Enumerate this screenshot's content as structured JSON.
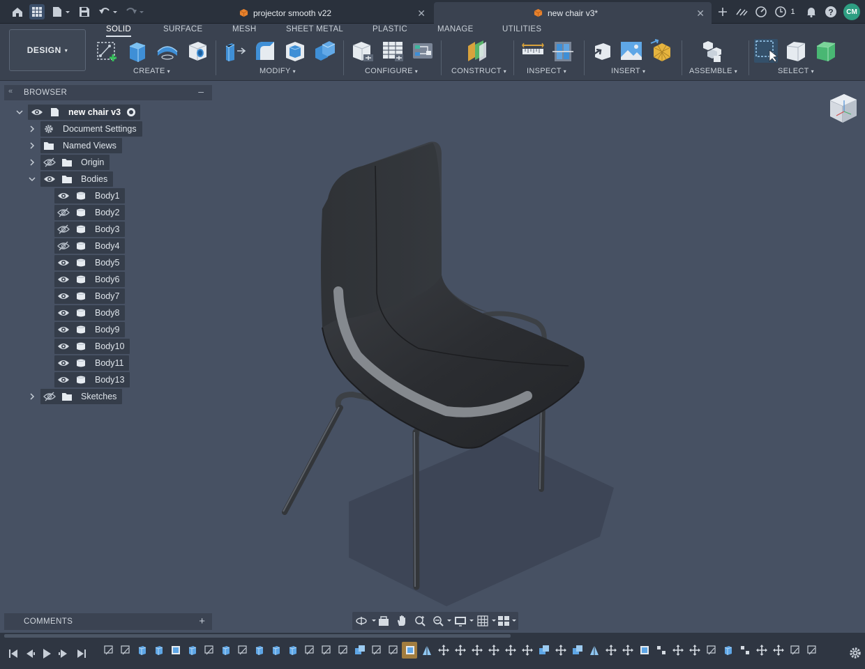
{
  "tabs": [
    {
      "title": "projector smooth v22",
      "active": false
    },
    {
      "title": "new chair v3*",
      "active": true
    }
  ],
  "titlebar": {
    "job_count": "1",
    "user_initials": "CM"
  },
  "workspace": {
    "label": "DESIGN",
    "caret": "▾"
  },
  "toolbar": {
    "tabs": [
      "SOLID",
      "SURFACE",
      "MESH",
      "SHEET METAL",
      "PLASTIC",
      "MANAGE",
      "UTILITIES"
    ],
    "groups": [
      "CREATE",
      "MODIFY",
      "CONFIGURE",
      "CONSTRUCT",
      "INSPECT",
      "INSERT",
      "ASSEMBLE",
      "SELECT"
    ],
    "caret": "▾"
  },
  "browser": {
    "title": "BROWSER",
    "root": "new chair v3",
    "folders": [
      "Document Settings",
      "Named Views",
      "Origin",
      "Bodies"
    ],
    "bodies": [
      {
        "name": "Body1",
        "visible": true
      },
      {
        "name": "Body2",
        "visible": false
      },
      {
        "name": "Body3",
        "visible": false
      },
      {
        "name": "Body4",
        "visible": false
      },
      {
        "name": "Body5",
        "visible": true
      },
      {
        "name": "Body6",
        "visible": true
      },
      {
        "name": "Body7",
        "visible": true
      },
      {
        "name": "Body8",
        "visible": true
      },
      {
        "name": "Body9",
        "visible": true
      },
      {
        "name": "Body10",
        "visible": true
      },
      {
        "name": "Body11",
        "visible": true
      },
      {
        "name": "Body13",
        "visible": true
      }
    ],
    "sketches": "Sketches"
  },
  "comments": {
    "title": "COMMENTS",
    "add": "+"
  },
  "colors": {
    "titlebar": "#2a313c",
    "toolbar": "#3a4250",
    "viewport": "#475163",
    "accent_green": "#2e9e82",
    "timeline_selected": "#b68a3e"
  }
}
